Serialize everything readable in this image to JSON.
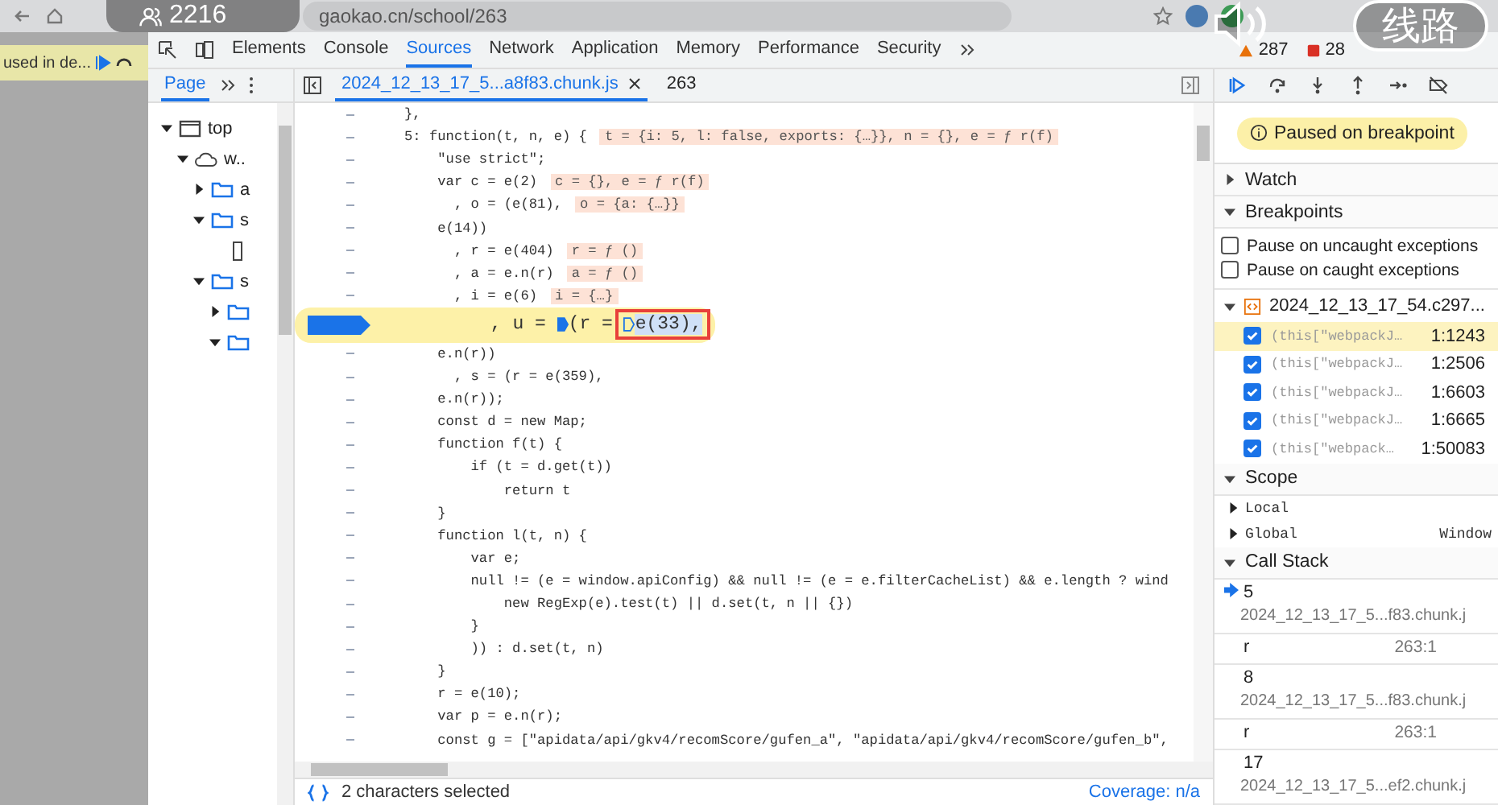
{
  "browser": {
    "address": "gaokao.cn/school/263"
  },
  "page": {
    "infobar": "used in de..."
  },
  "overlay": {
    "viewers": "2216",
    "route": "线路"
  },
  "devtools": {
    "tabs": [
      {
        "label": "Elements",
        "selected": false
      },
      {
        "label": "Console",
        "selected": false
      },
      {
        "label": "Sources",
        "selected": true
      },
      {
        "label": "Network",
        "selected": false
      },
      {
        "label": "Application",
        "selected": false
      },
      {
        "label": "Memory",
        "selected": false
      },
      {
        "label": "Performance",
        "selected": false
      },
      {
        "label": "Security",
        "selected": false
      }
    ],
    "warnings": "287",
    "errors": "28"
  },
  "navigator": {
    "tabs": [
      {
        "label": "Page",
        "selected": true
      }
    ],
    "tree": [
      {
        "kind": "frame",
        "label": "top",
        "expanded": true,
        "children": [
          {
            "kind": "origin",
            "label": "w..",
            "expanded": true,
            "children": [
              {
                "kind": "folder",
                "label": "a",
                "expanded": false
              },
              {
                "kind": "folder",
                "label": "s",
                "expanded": true,
                "children": [
                  {
                    "kind": "file"
                  }
                ]
              },
              {
                "kind": "folder",
                "label": "s",
                "expanded": true,
                "children": [
                  {
                    "kind": "folder",
                    "expanded": false
                  },
                  {
                    "kind": "folder",
                    "expanded": true
                  }
                ]
              }
            ]
          }
        ]
      }
    ]
  },
  "editor": {
    "tabs": [
      {
        "label": "2024_12_13_17_5...a8f83.chunk.js",
        "selected": true
      },
      {
        "label": "263",
        "selected": false
      }
    ],
    "lines": [
      {
        "code": "},",
        "selected": false
      },
      {
        "code": "5: function(t, n, e) {",
        "value": "t = {i: 5, l: false, exports: {…}}, n = {}, e = ƒ r(f)",
        "selected": false
      },
      {
        "code": "    \"use strict\";",
        "selected": false
      },
      {
        "code": "    var c = e(2)",
        "value": "c = {}, e = ƒ r(f)",
        "selected": false
      },
      {
        "code": "      , o = (e(81),",
        "value": "o = {a: {…}}",
        "selected": false
      },
      {
        "code": "    e(14))",
        "selected": false
      },
      {
        "code": "      , r = e(404)",
        "value": "r = ƒ ()",
        "selected": false
      },
      {
        "code": "      , a = e.n(r)",
        "value": "a = ƒ ()",
        "selected": false
      },
      {
        "code": "      , i = e(6)",
        "value": "i = {…}",
        "selected": false
      },
      {
        "selected": true,
        "parts": [
          {
            "kind": "text",
            "text": "      , u = "
          },
          {
            "kind": "marker",
            "on": true
          },
          {
            "kind": "text",
            "text": "(r = "
          },
          {
            "kind": "boxed",
            "parts": [
              {
                "kind": "marker",
                "on": false
              },
              {
                "kind": "text",
                "text": "e(33),"
              }
            ]
          }
        ]
      },
      {
        "code": "    e.n(r))",
        "selected": false
      },
      {
        "code": "      , s = (r = e(359),",
        "selected": false
      },
      {
        "code": "    e.n(r));",
        "selected": false
      },
      {
        "code": "    const d = new Map;",
        "selected": false
      },
      {
        "code": "    function f(t) {",
        "selected": false
      },
      {
        "code": "        if (t = d.get(t))",
        "selected": false
      },
      {
        "code": "            return t",
        "selected": false
      },
      {
        "code": "    }",
        "selected": false
      },
      {
        "code": "    function l(t, n) {",
        "selected": false
      },
      {
        "code": "        var e;",
        "selected": false
      },
      {
        "code": "        null != (e = window.apiConfig) && null != (e = e.filterCacheList) && e.length ? wind",
        "selected": false
      },
      {
        "code": "            new RegExp(e).test(t) || d.set(t, n || {})",
        "selected": false
      },
      {
        "code": "        }",
        "selected": false
      },
      {
        "code": "        )) : d.set(t, n)",
        "selected": false
      },
      {
        "code": "    }",
        "selected": false
      },
      {
        "code": "    r = e(10);",
        "selected": false
      },
      {
        "code": "    var p = e.n(r);",
        "selected": false
      },
      {
        "code": "    const g = [\"apidata/api/gkv4/recomScore/gufen_a\", \"apidata/api/gkv4/recomScore/gufen_b\",",
        "selected": false
      }
    ],
    "status": {
      "selection": "2 characters selected",
      "coverage": "Coverage: n/a"
    }
  },
  "debugger": {
    "paused_message": "Paused on breakpoint",
    "watch": {
      "title": "Watch",
      "expanded": false
    },
    "breakpoints": {
      "title": "Breakpoints",
      "expanded": true,
      "options": [
        {
          "label": "Pause on uncaught exceptions",
          "checked": false
        },
        {
          "label": "Pause on caught exceptions",
          "checked": false
        }
      ],
      "files": [
        {
          "name": "2024_12_13_17_54.c297...",
          "expanded": true,
          "items": [
            {
              "code": "(this[\"webpackJ…",
              "line": "1:1243",
              "checked": true,
              "selected": true
            },
            {
              "code": "(this[\"webpackJ…",
              "line": "1:2506",
              "checked": true,
              "selected": false
            },
            {
              "code": "(this[\"webpackJ…",
              "line": "1:6603",
              "checked": true,
              "selected": false
            },
            {
              "code": "(this[\"webpackJ…",
              "line": "1:6665",
              "checked": true,
              "selected": false
            },
            {
              "code": "(this[\"webpack…",
              "line": "1:50083",
              "checked": true,
              "selected": false
            }
          ]
        }
      ]
    },
    "scope": {
      "title": "Scope",
      "expanded": true,
      "items": [
        {
          "name": "Local",
          "expanded": false
        },
        {
          "name": "Global",
          "value": "Window",
          "expanded": false
        }
      ]
    },
    "call_stack": {
      "title": "Call Stack",
      "expanded": true,
      "frames": [
        {
          "kind": "two_line",
          "name": "5",
          "location": "2024_12_13_17_5...f83.chunk.j",
          "selected": true
        },
        {
          "kind": "one_line",
          "name": "r",
          "location": "263:1",
          "selected": false
        },
        {
          "kind": "two_line",
          "name": "8",
          "location": "2024_12_13_17_5...f83.chunk.j",
          "selected": false
        },
        {
          "kind": "one_line",
          "name": "r",
          "location": "263:1",
          "selected": false
        },
        {
          "kind": "two_line",
          "name": "17",
          "location": "2024_12_13_17_5...ef2.chunk.j",
          "selected": false
        }
      ]
    }
  }
}
